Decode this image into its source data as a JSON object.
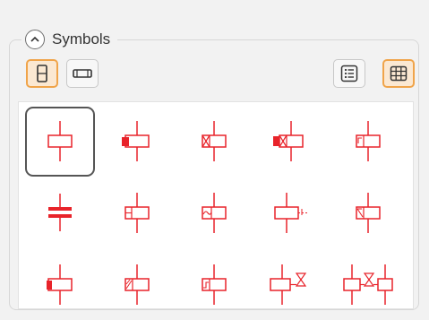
{
  "group": {
    "title": "Symbols",
    "collapse_icon": "chevron-up-icon"
  },
  "toolbar": {
    "orientation": [
      {
        "name": "vertical-orientation-button",
        "icon": "vertical-symbol-icon",
        "active": true
      },
      {
        "name": "horizontal-orientation-button",
        "icon": "horizontal-symbol-icon",
        "active": false
      }
    ],
    "view": [
      {
        "name": "list-view-button",
        "icon": "list-icon",
        "active": false
      },
      {
        "name": "grid-view-button",
        "icon": "grid-icon",
        "active": true
      }
    ]
  },
  "colors": {
    "symbol": "#e8232a",
    "accent": "#f0a44a",
    "accent_bg": "#fbe8d2",
    "selection": "#555555"
  },
  "symbols": [
    {
      "name": "symbol-coil",
      "selected": true
    },
    {
      "name": "symbol-coil-solid-marker"
    },
    {
      "name": "symbol-coil-cross"
    },
    {
      "name": "symbol-coil-solid-cross"
    },
    {
      "name": "symbol-coil-corner"
    },
    {
      "name": "symbol-double-bar"
    },
    {
      "name": "symbol-coil-left-box"
    },
    {
      "name": "symbol-coil-wave"
    },
    {
      "name": "symbol-coil-dashed"
    },
    {
      "name": "symbol-coil-corner-cross"
    },
    {
      "name": "symbol-coil-solid-small"
    },
    {
      "name": "symbol-coil-hatched"
    },
    {
      "name": "symbol-coil-step"
    },
    {
      "name": "symbol-valve"
    },
    {
      "name": "symbol-coil-valve"
    }
  ]
}
